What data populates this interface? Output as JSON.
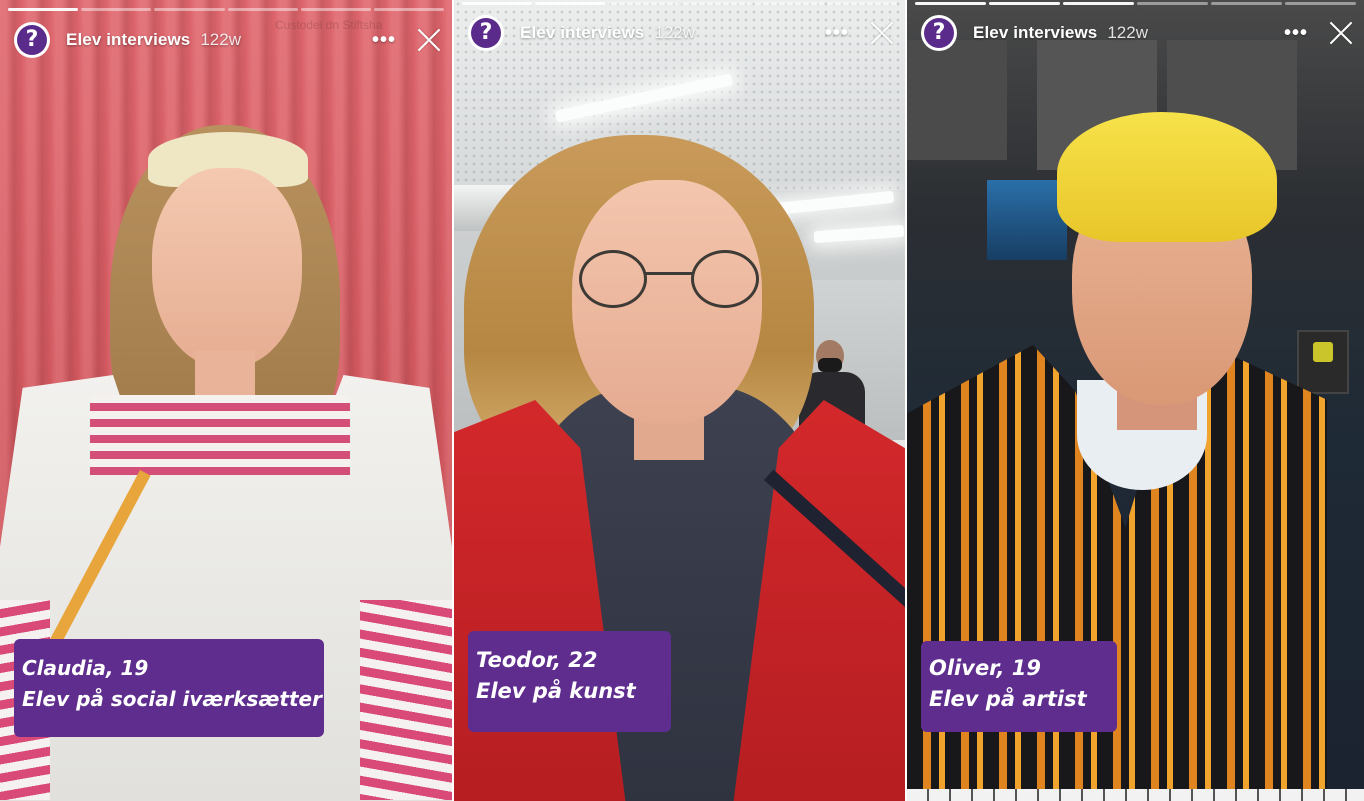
{
  "stories": [
    {
      "account": "Elev interviews",
      "age": "122w",
      "avatar_glyph": "?",
      "more_glyph": "•••",
      "watermark": "Custodei dn Stiftsha",
      "caption": {
        "line1": "Claudia, 19",
        "line2": "Elev på social iværksætter"
      }
    },
    {
      "account": "Elev interviews",
      "age": "122w",
      "avatar_glyph": "?",
      "more_glyph": "•••",
      "caption": {
        "line1": "Teodor, 22",
        "line2": "Elev på kunst"
      }
    },
    {
      "account": "Elev interviews",
      "age": "122w",
      "avatar_glyph": "?",
      "more_glyph": "•••",
      "caption": {
        "line1": "Oliver, 19",
        "line2": "Elev på artist"
      }
    }
  ],
  "colors": {
    "caption_bg": "#5e2d8e",
    "avatar_bg": "#5b2b8c"
  },
  "icons": {
    "avatar": "question-mark-avatar-icon",
    "more": "more-options-icon",
    "close": "close-icon"
  }
}
